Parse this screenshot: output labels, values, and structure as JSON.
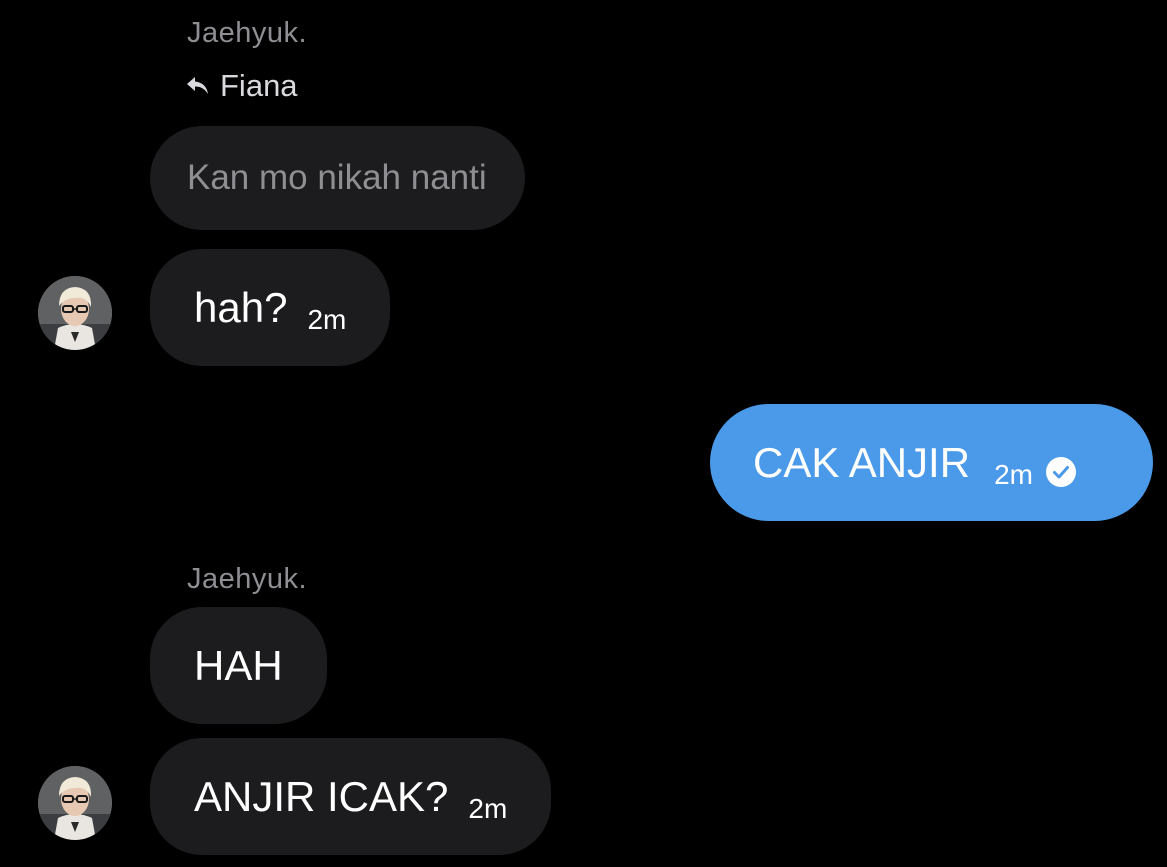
{
  "conversation": {
    "group1": {
      "sender": "Jaehyuk.",
      "reply_to": "Fiana",
      "reply_icon": "reply-arrow-icon",
      "quoted_text": "Kan mo nikah nanti",
      "message": {
        "text": "hah?",
        "time": "2m"
      }
    },
    "outgoing": {
      "text": "CAK ANJIR",
      "time": "2m",
      "status_icon": "read-check-icon"
    },
    "group2": {
      "sender": "Jaehyuk.",
      "messages": [
        {
          "text": "HAH"
        },
        {
          "text": "ANJIR ICAK?",
          "time": "2m"
        }
      ]
    }
  },
  "colors": {
    "background": "#000000",
    "incoming_bubble": "#1c1c1e",
    "outgoing_bubble": "#4a9ae9",
    "sender_name": "#8e8e93"
  }
}
